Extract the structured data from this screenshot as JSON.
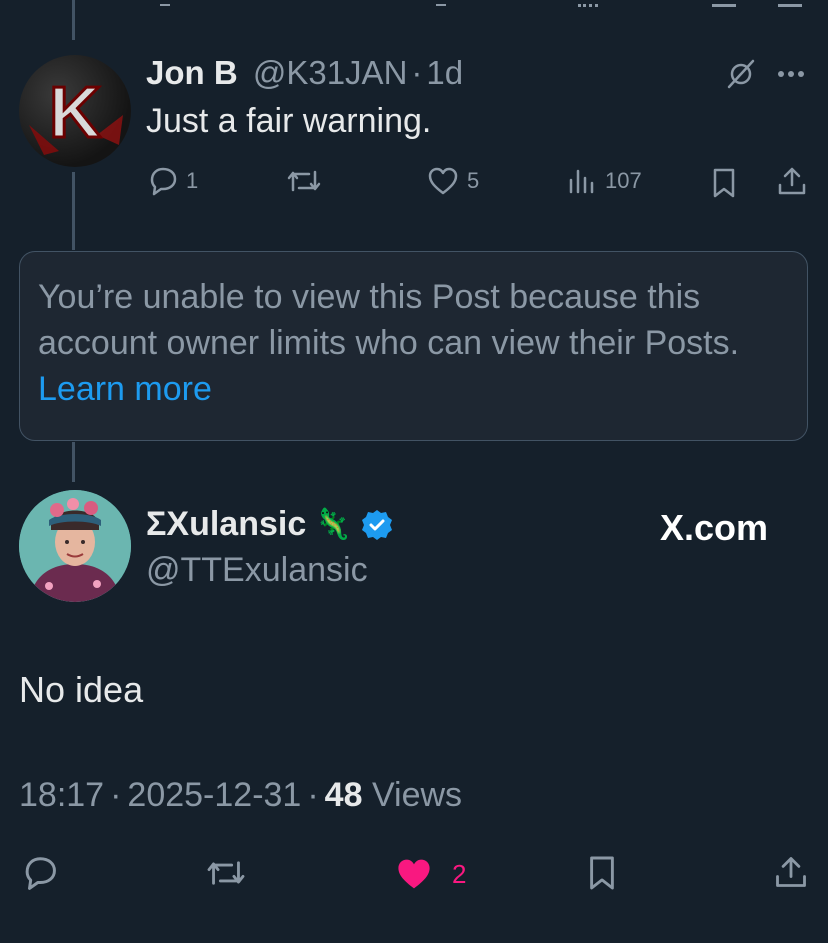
{
  "colors": {
    "background": "#15202b",
    "text": "#e7e9ea",
    "muted": "#8b98a5",
    "link": "#1d9bf0",
    "like_active": "#f91880",
    "verified": "#1d9bf0"
  },
  "reply": {
    "name": "Jon B",
    "handle": "@K31JAN",
    "separator": "·",
    "time": "1d",
    "text": "Just a fair warning.",
    "avatar_letter": "K",
    "stats": {
      "replies": "1",
      "reposts": "",
      "likes": "5",
      "views": "107"
    },
    "icons": [
      "grok-icon",
      "more-icon",
      "reply-icon",
      "repost-icon",
      "like-icon",
      "views-icon",
      "bookmark-icon",
      "share-icon"
    ]
  },
  "blocked_notice": {
    "message": "You’re unable to view this Post because this account owner limits who can view their Posts. ",
    "link_text": "Learn more"
  },
  "main_post": {
    "name": "ΣXulansic",
    "emoji": "🦎",
    "handle": "@TTExulansic",
    "watermark": "X.com",
    "text": "No idea",
    "time": "18:17",
    "date": "2025-12-31",
    "separator": "·",
    "views_count": "48",
    "views_label": "Views",
    "stats": {
      "likes": "2"
    }
  }
}
